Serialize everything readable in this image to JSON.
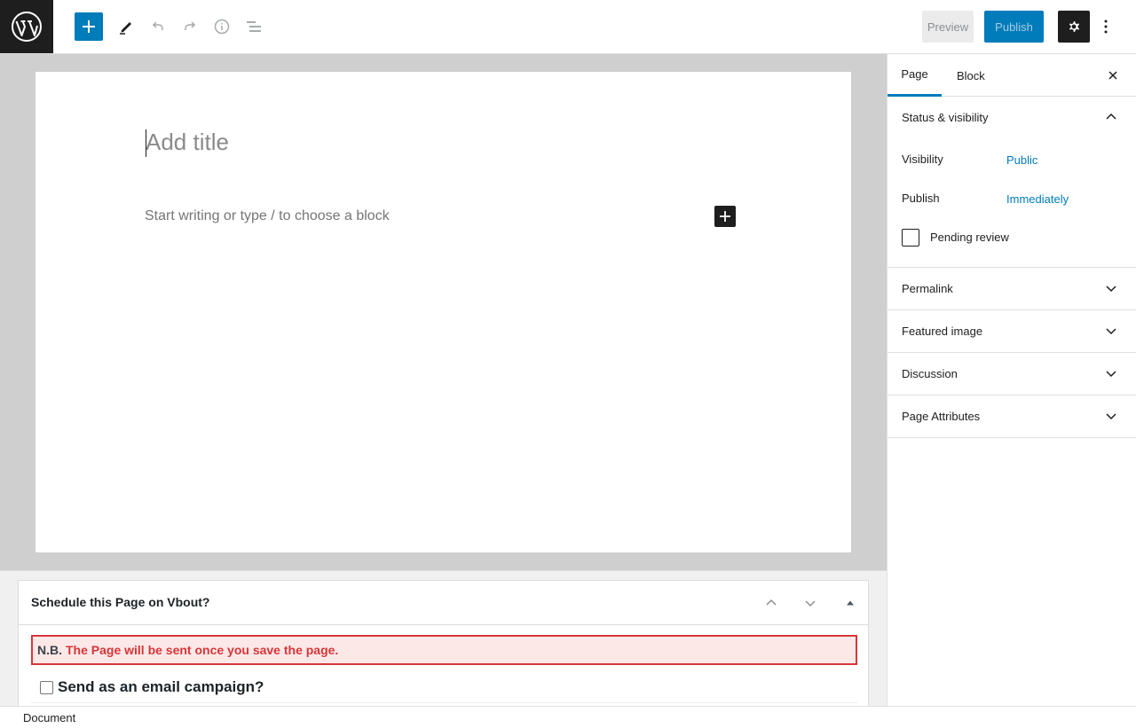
{
  "toolbar": {
    "logo": "wordpress-logo",
    "preview_label": "Preview",
    "publish_label": "Publish"
  },
  "editor": {
    "title_placeholder": "Add title",
    "block_placeholder": "Start writing or type / to choose a block"
  },
  "metabox": {
    "title": "Schedule this Page on Vbout?",
    "notice_prefix": "N.B.",
    "notice_message": "The Page will be sent once you save the page.",
    "email_campaign_label": "Send as an email campaign?"
  },
  "sidebar": {
    "tabs": [
      {
        "label": "Page",
        "active": true
      },
      {
        "label": "Block",
        "active": false
      }
    ],
    "status_panel": {
      "title": "Status & visibility",
      "visibility_label": "Visibility",
      "visibility_value": "Public",
      "publish_label": "Publish",
      "publish_value": "Immediately",
      "pending_label": "Pending review"
    },
    "panels": [
      {
        "label": "Permalink"
      },
      {
        "label": "Featured image"
      },
      {
        "label": "Discussion"
      },
      {
        "label": "Page Attributes"
      }
    ]
  },
  "footer": {
    "breadcrumb": "Document"
  },
  "colors": {
    "accent": "#007cba",
    "dark": "#1e1e1e",
    "notice_red": "#d63638"
  }
}
